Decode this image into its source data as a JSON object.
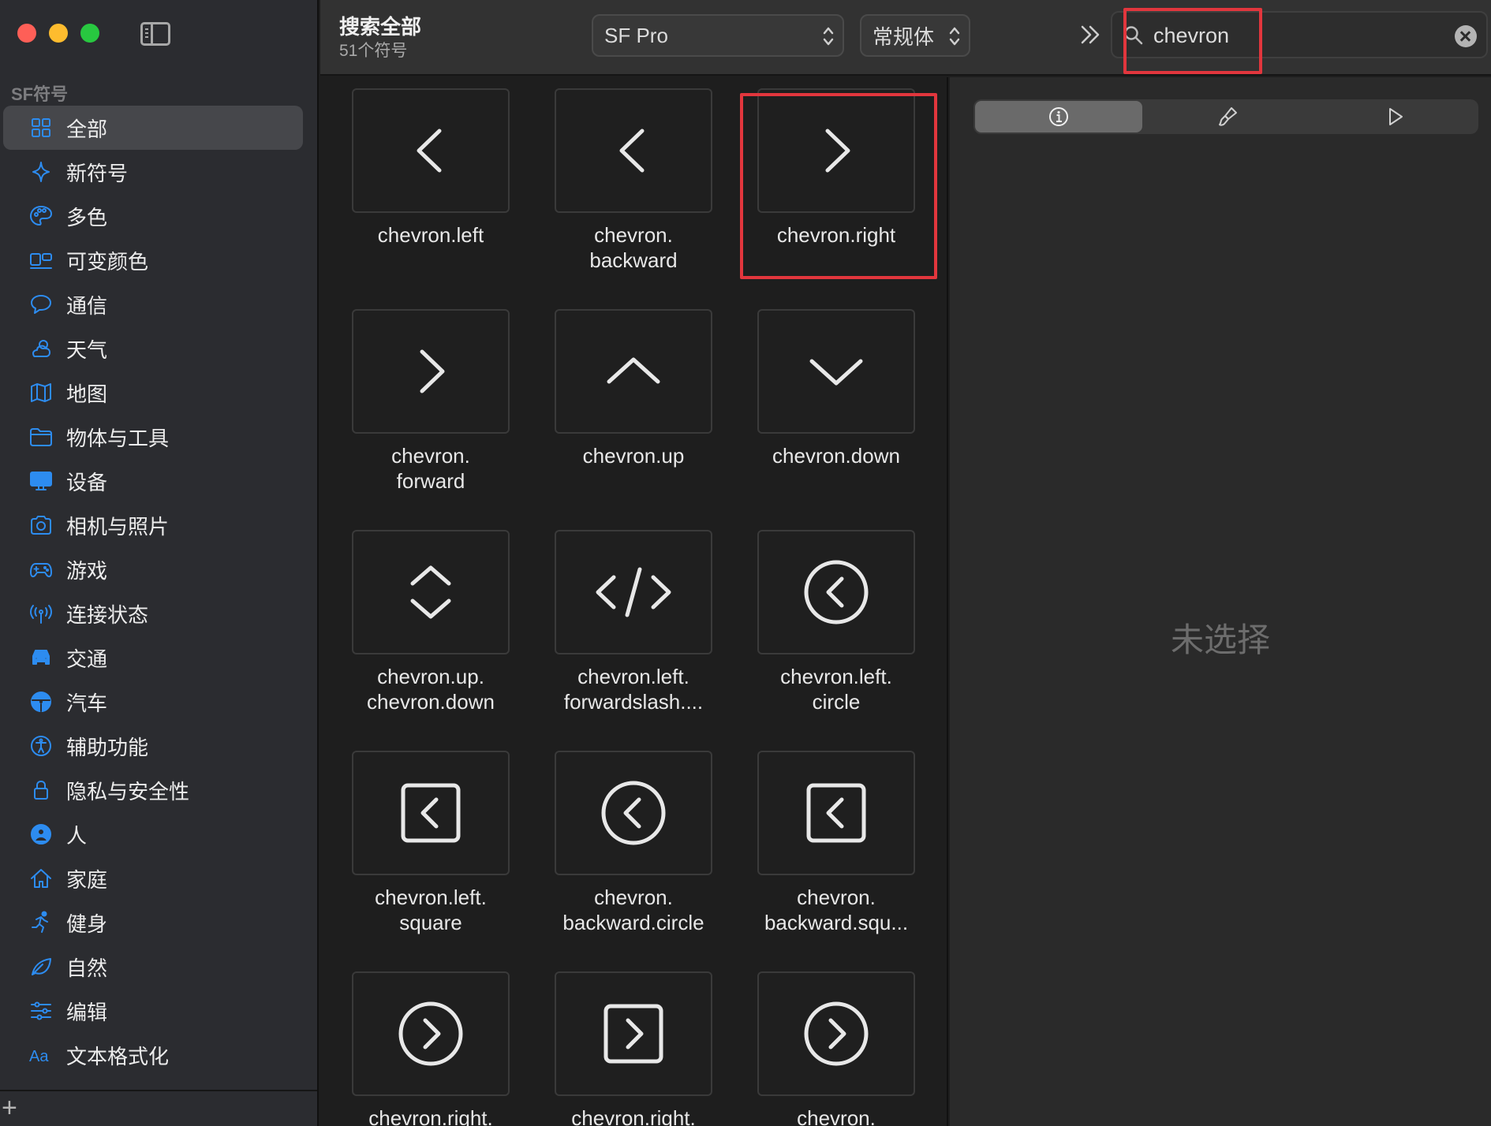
{
  "sidebar": {
    "section_title": "SF符号",
    "items": [
      {
        "label": "全部",
        "icon": "grid-icon"
      },
      {
        "label": "新符号",
        "icon": "sparkle-icon"
      },
      {
        "label": "多色",
        "icon": "palette-icon"
      },
      {
        "label": "可变颜色",
        "icon": "variable-color-icon"
      },
      {
        "label": "通信",
        "icon": "message-bubble-icon"
      },
      {
        "label": "天气",
        "icon": "cloud-sun-icon"
      },
      {
        "label": "地图",
        "icon": "map-icon"
      },
      {
        "label": "物体与工具",
        "icon": "folder-icon"
      },
      {
        "label": "设备",
        "icon": "display-icon"
      },
      {
        "label": "相机与照片",
        "icon": "camera-icon"
      },
      {
        "label": "游戏",
        "icon": "gamecontroller-icon"
      },
      {
        "label": "连接状态",
        "icon": "antenna-icon"
      },
      {
        "label": "交通",
        "icon": "car-front-icon"
      },
      {
        "label": "汽车",
        "icon": "steering-wheel-icon"
      },
      {
        "label": "辅助功能",
        "icon": "accessibility-icon"
      },
      {
        "label": "隐私与安全性",
        "icon": "lock-icon"
      },
      {
        "label": "人",
        "icon": "person-circle-icon"
      },
      {
        "label": "家庭",
        "icon": "house-icon"
      },
      {
        "label": "健身",
        "icon": "figure-run-icon"
      },
      {
        "label": "自然",
        "icon": "leaf-icon"
      },
      {
        "label": "编辑",
        "icon": "sliders-icon"
      },
      {
        "label": "文本格式化",
        "icon": "text-format-icon"
      }
    ],
    "add_label": "+"
  },
  "toolbar": {
    "title": "搜索全部",
    "subtitle": "51个符号",
    "font_popup": "SF Pro",
    "weight_popup": "常规体",
    "search_value": "chevron"
  },
  "symbols": [
    {
      "name": "chevron.left",
      "icon": "chevron-left-icon"
    },
    {
      "name": "chevron.\nbackward",
      "icon": "chevron-backward-icon"
    },
    {
      "name": "chevron.right",
      "icon": "chevron-right-icon"
    },
    {
      "name": "chevron.\nforward",
      "icon": "chevron-forward-icon"
    },
    {
      "name": "chevron.up",
      "icon": "chevron-up-icon"
    },
    {
      "name": "chevron.down",
      "icon": "chevron-down-icon"
    },
    {
      "name": "chevron.up.\nchevron.down",
      "icon": "chevron-up-down-icon"
    },
    {
      "name": "chevron.left.\nforwardslash....",
      "icon": "code-brackets-icon"
    },
    {
      "name": "chevron.left.\ncircle",
      "icon": "chevron-left-circle-icon"
    },
    {
      "name": "chevron.left.\nsquare",
      "icon": "chevron-left-square-icon"
    },
    {
      "name": "chevron.\nbackward.circle",
      "icon": "chevron-backward-circle-icon"
    },
    {
      "name": "chevron.\nbackward.squ...",
      "icon": "chevron-backward-square-icon"
    },
    {
      "name": "chevron.right.",
      "icon": "chevron-right-circle-icon"
    },
    {
      "name": "chevron.right.",
      "icon": "chevron-right-square-icon"
    },
    {
      "name": "chevron.",
      "icon": "chevron-forward-circle-icon"
    }
  ],
  "inspector": {
    "tabs": [
      "info-icon",
      "paintbrush-icon",
      "play-icon"
    ],
    "empty_text": "未选择"
  },
  "colors": {
    "accent": "#2d8cf0",
    "highlight": "#e2363d"
  }
}
